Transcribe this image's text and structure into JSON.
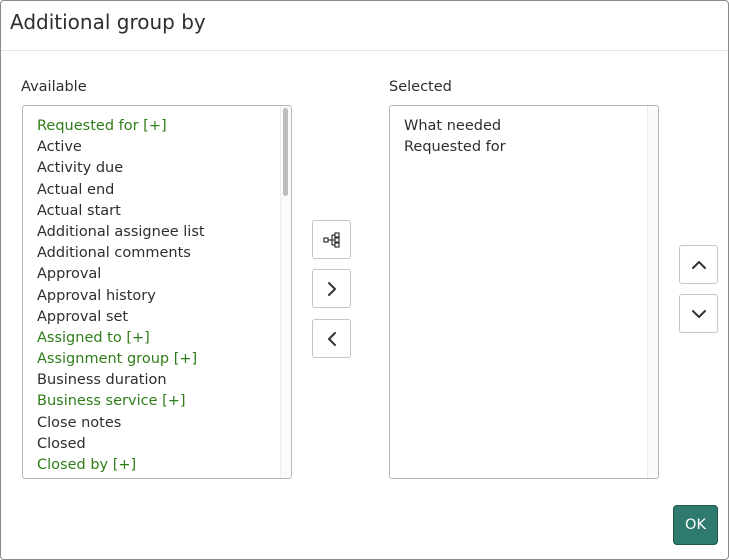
{
  "dialog": {
    "title": "Additional group by",
    "ok_label": "OK"
  },
  "available": {
    "label": "Available",
    "items": [
      {
        "label": "Requested for [+]",
        "expandable": true
      },
      {
        "label": "Active",
        "expandable": false
      },
      {
        "label": "Activity due",
        "expandable": false
      },
      {
        "label": "Actual end",
        "expandable": false
      },
      {
        "label": "Actual start",
        "expandable": false
      },
      {
        "label": "Additional assignee list",
        "expandable": false
      },
      {
        "label": "Additional comments",
        "expandable": false
      },
      {
        "label": "Approval",
        "expandable": false
      },
      {
        "label": "Approval history",
        "expandable": false
      },
      {
        "label": "Approval set",
        "expandable": false
      },
      {
        "label": "Assigned to [+]",
        "expandable": true
      },
      {
        "label": "Assignment group [+]",
        "expandable": true
      },
      {
        "label": "Business duration",
        "expandable": false
      },
      {
        "label": "Business service [+]",
        "expandable": true
      },
      {
        "label": "Close notes",
        "expandable": false
      },
      {
        "label": "Closed",
        "expandable": false
      },
      {
        "label": "Closed by [+]",
        "expandable": true
      }
    ]
  },
  "selected": {
    "label": "Selected",
    "items": [
      {
        "label": "What needed"
      },
      {
        "label": "Requested for"
      }
    ]
  },
  "icons": {
    "expand": "hierarchy-icon",
    "add": "chevron-right-icon",
    "remove": "chevron-left-icon",
    "move_up": "chevron-up-icon",
    "move_down": "chevron-down-icon"
  },
  "colors": {
    "expandable_text": "#2f7d18",
    "ok_background": "#2e7a6e",
    "text": "#2e2e2e"
  }
}
